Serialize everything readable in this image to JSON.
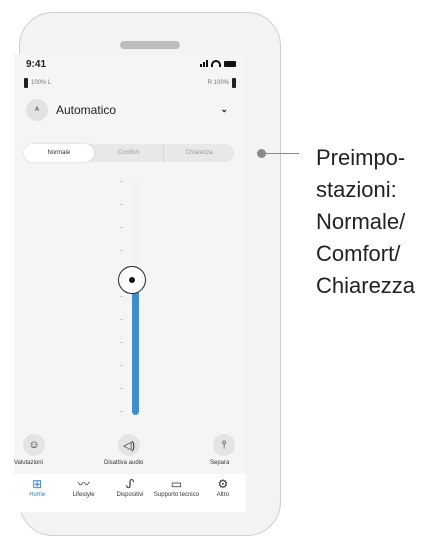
{
  "status": {
    "time": "9:41"
  },
  "hearing_aids": {
    "left_battery": "100% L",
    "right_battery": "R 100%"
  },
  "program": {
    "label": "Automatico",
    "icon": "ear-auto-icon",
    "dropdown_icon": "chevron-down-icon"
  },
  "presets": {
    "items": [
      "Normale",
      "Comfort",
      "Chiarezza"
    ],
    "selected": "Normale"
  },
  "volume": {
    "level": 0.57
  },
  "actions": [
    {
      "label": "Valutazioni",
      "icon": "smiley-icon"
    },
    {
      "label": "Disattiva audio",
      "icon": "speaker-mute-icon"
    },
    {
      "label": "Separa",
      "icon": "split-icon"
    }
  ],
  "tabs": [
    {
      "label": "Home",
      "icon": "grid-icon",
      "active": true
    },
    {
      "label": "Lifestyle",
      "icon": "activity-icon"
    },
    {
      "label": "Dispositivi",
      "icon": "hearing-aid-icon"
    },
    {
      "label": "Supporto tecnico",
      "icon": "chat-icon"
    },
    {
      "label": "Altro",
      "icon": "gear-icon"
    }
  ],
  "callout": {
    "lines": [
      "Preimpo-",
      "stazioni:",
      "Normale/",
      "Comfort/",
      "Chiarezza"
    ]
  }
}
